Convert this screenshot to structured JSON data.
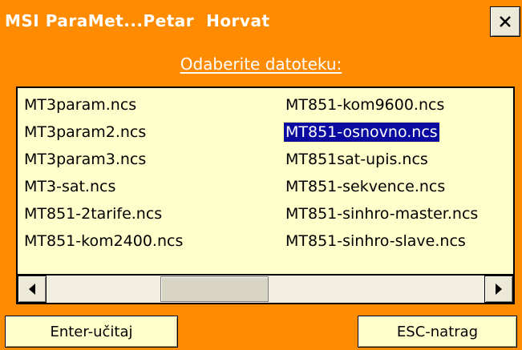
{
  "window": {
    "title": "MSI ParaMet...Petar  Horvat",
    "close_label": "×"
  },
  "heading": "Odaberite datoteku:",
  "files": {
    "left_column": [
      "MT3param.ncs",
      "MT3param2.ncs",
      "MT3param3.ncs",
      "MT3-sat.ncs",
      "MT851-2tarife.ncs",
      "MT851-kom2400.ncs"
    ],
    "right_column": [
      "MT851-kom9600.ncs",
      "MT851-osnovno.ncs",
      "MT851sat-upis.ncs",
      "MT851-sekvence.ncs",
      "MT851-sinhro-master.ncs",
      "MT851-sinhro-slave.ncs"
    ],
    "selected": "MT851-osnovno.ncs"
  },
  "buttons": {
    "enter_label": "Enter-učitaj",
    "esc_label": "ESC-natrag"
  },
  "colors": {
    "window_bg": "#ff8c00",
    "list_bg": "#ffffcc",
    "selection_bg": "#0a0aa0",
    "title_text": "#ffffff"
  }
}
